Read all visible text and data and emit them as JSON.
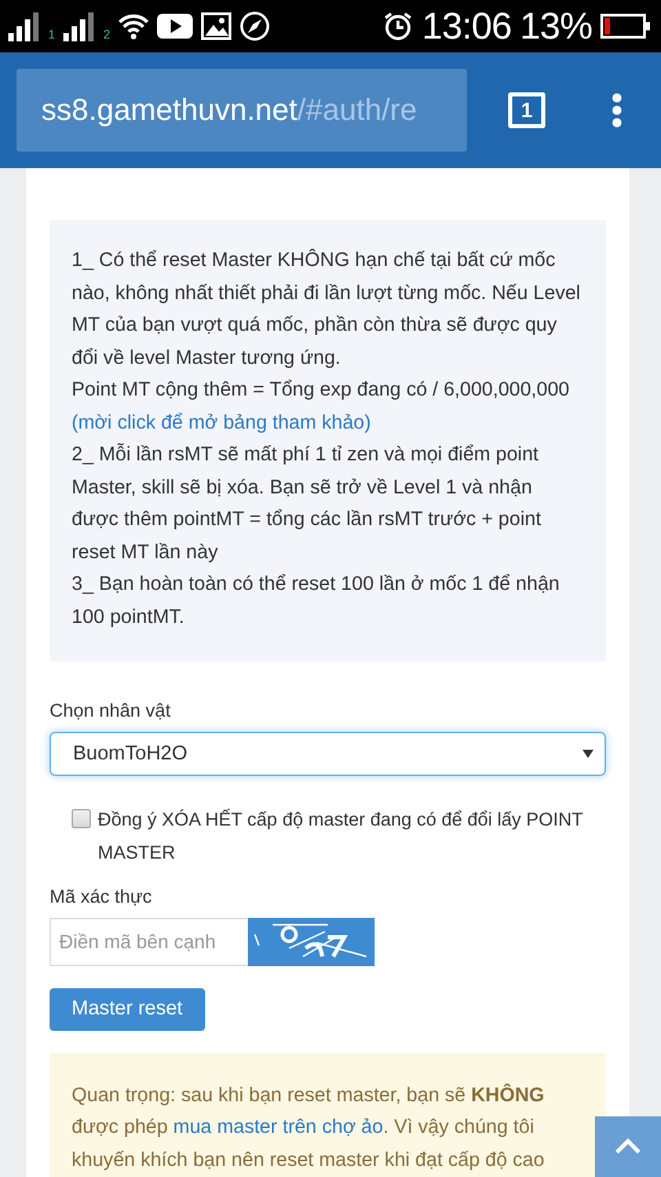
{
  "status_bar": {
    "time": "13:06",
    "battery_text": "13%",
    "sim_labels": [
      "1",
      "2"
    ]
  },
  "browser": {
    "url_host": "ss8.gamethuvn.net",
    "url_path": "/#auth/re",
    "tab_count": "1"
  },
  "info_box": {
    "lines": [
      {
        "kind": "text",
        "text": "1_ Có thể reset Master KHÔNG hạn chế tại bất cứ mốc nào, không nhất thiết phải đi lần lượt từng mốc. Nếu Level MT của bạn vượt quá mốc, phần còn thừa sẽ được quy đổi về level Master tương ứng."
      },
      {
        "kind": "text",
        "text": "Point MT cộng thêm = Tổng exp đang có / 6,000,000,000"
      },
      {
        "kind": "link",
        "text": "(mời click để mở bảng tham khảo)"
      },
      {
        "kind": "text",
        "text": "2_ Mỗi lần rsMT sẽ mất phí 1 tỉ zen và mọi điểm point Master, skill sẽ bị xóa. Bạn sẽ trở về Level 1 và nhận được thêm pointMT = tổng các lần rsMT trước + point reset MT lần này"
      },
      {
        "kind": "text",
        "text": "3_ Bạn hoàn toàn có thể reset 100 lần ở mốc 1 để nhận 100 pointMT."
      }
    ]
  },
  "character": {
    "label": "Chọn nhân vật",
    "value": "BuomToH2O"
  },
  "agree": {
    "label": "Đồng ý XÓA HẾT cấp độ master đang có để đổi lấy POINT MASTER",
    "checked": false
  },
  "captcha": {
    "label": "Mã xác thực",
    "placeholder": "Điền mã bên cạnh"
  },
  "submit": {
    "label": "Master reset"
  },
  "warning": {
    "before": "Quan trọng: sau khi bạn reset master, bạn sẽ **KHÔNG** được phép ",
    "link": "mua master trên chợ ảo",
    "after": ". Vì vậy chúng tôi khuyến khích bạn nên reset master khi đạt cấp độ cao"
  }
}
